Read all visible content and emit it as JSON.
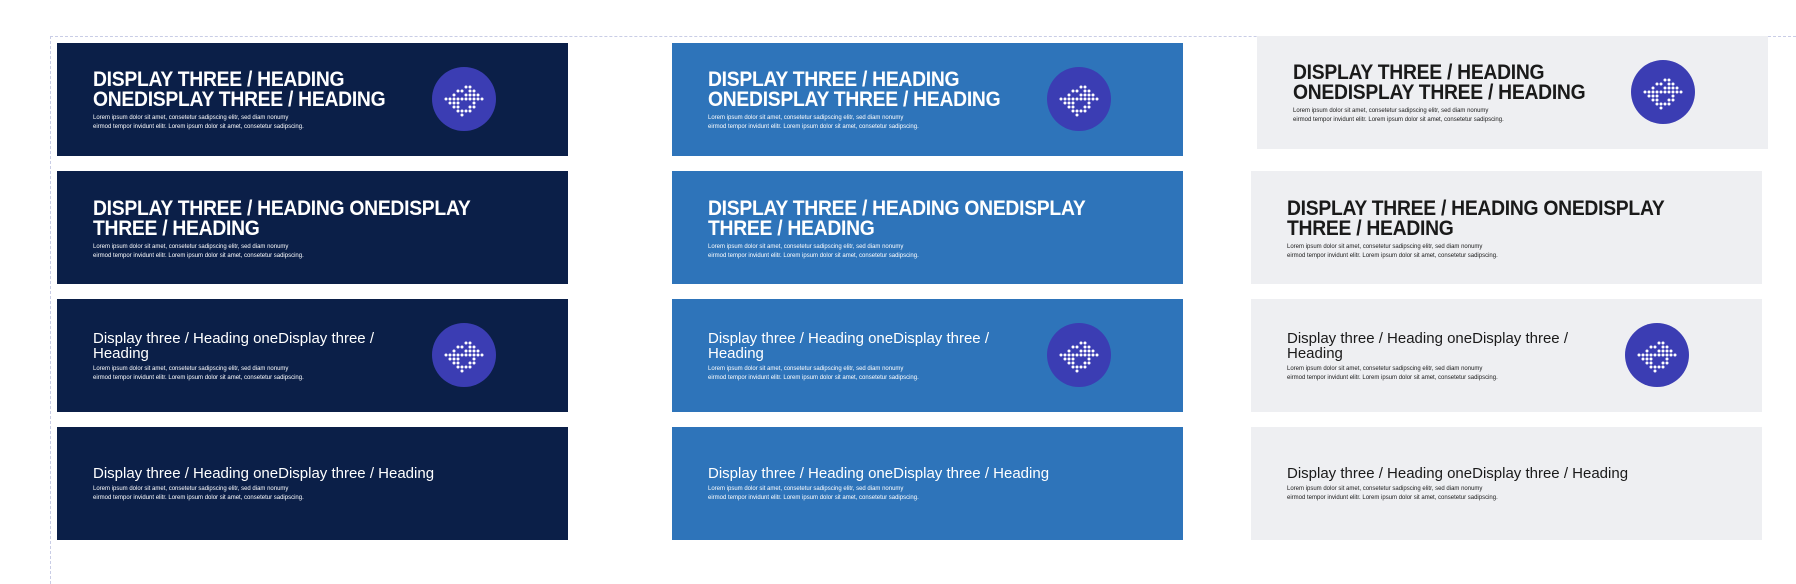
{
  "colors": {
    "dark_bg": "#0b1f48",
    "blue_bg": "#2e74ba",
    "light_bg": "#eeeff2",
    "icon_circle": "#3b3db3"
  },
  "icon_name": "dotted-arrows-icon",
  "rows": [
    {
      "style": "uppercase-icon",
      "title": "DISPLAY THREE / HEADING ONEDISPLAY THREE / HEADING",
      "body_line1": "Lorem ipsum dolor sit amet, consetetur sadipscing elitr, sed diam nonumy",
      "body_line2": "eirmod tempor invidunt elitr. Lorem ipsum dolor sit amet, consetetur sadipscing."
    },
    {
      "style": "uppercase",
      "title": "DISPLAY THREE / HEADING ONEDISPLAY THREE / HEADING",
      "body_line1": "Lorem ipsum dolor sit amet, consetetur sadipscing elitr, sed diam nonumy",
      "body_line2": "eirmod tempor invidunt elitr. Lorem ipsum dolor sit amet, consetetur sadipscing."
    },
    {
      "style": "sentence-icon",
      "title": "Display three / Heading oneDisplay three / Heading",
      "body_line1": "Lorem ipsum dolor sit amet, consetetur sadipscing elitr, sed diam nonumy",
      "body_line2": "eirmod tempor invidunt elitr. Lorem ipsum dolor sit amet, consetetur sadipscing."
    },
    {
      "style": "sentence",
      "title": "Display three / Heading oneDisplay three / Heading",
      "body_line1": "Lorem ipsum dolor sit amet, consetetur sadipscing elitr, sed diam nonumy",
      "body_line2": "eirmod tempor invidunt elitr. Lorem ipsum dolor sit amet, consetetur sadipscing."
    }
  ]
}
